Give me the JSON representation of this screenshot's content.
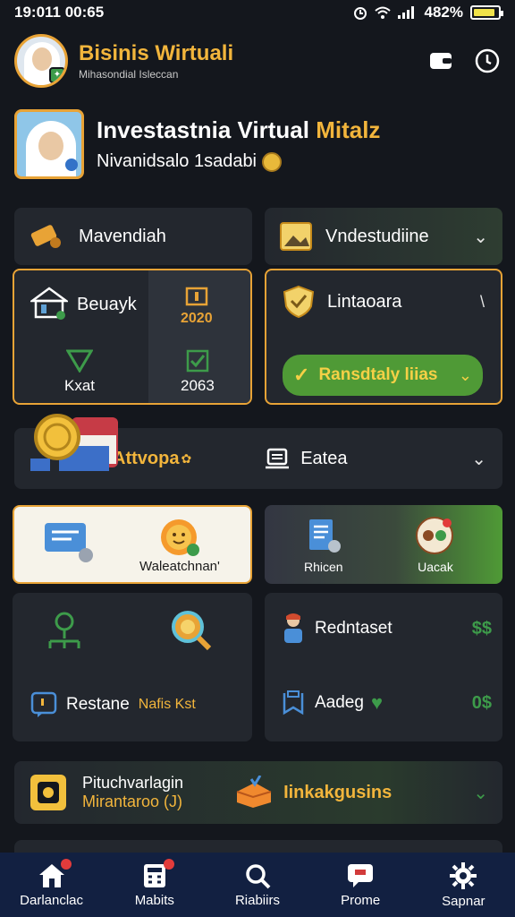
{
  "status": {
    "time": "19:011 00:65",
    "battery": "482%",
    "battery_level": 0.9
  },
  "header": {
    "title": "Bisinis Wirtuali",
    "subtitle": "Mihasondial Isleccan"
  },
  "profile": {
    "title_main": "Investastnia Virtual",
    "title_accent": "Mitalz",
    "subtitle": "Nivanidsalo 1sadabi"
  },
  "row1": {
    "left_label": "Mavendiah",
    "right_label": "Vndestudiine"
  },
  "panel_left": {
    "top_label": "Beuayk",
    "top_value": "2020",
    "bottom_left": "Kxat",
    "bottom_right": "2063"
  },
  "panel_right": {
    "title": "Lintaoara",
    "button_label": "Ransdtaly liias"
  },
  "banner": {
    "left_label": "Attvopa",
    "right_label": "Eatea"
  },
  "row4": {
    "left_caption": "Waleatchnan'",
    "mid_caption": "Rhicen",
    "right_caption": "Uacak"
  },
  "grid": {
    "left_label": "Restane",
    "left_value": "Nafis Kst",
    "right_top_label": "Redntaset",
    "right_top_value": "$$",
    "right_bottom_label": "Aadeg",
    "right_bottom_value": "0$"
  },
  "bottom_card": {
    "line1": "Pituchvarlagin",
    "line2": "Mirantaroo (J)",
    "right_label": "Iinkakgusins"
  },
  "nav": [
    {
      "label": "Darlanclac",
      "icon": "home-icon"
    },
    {
      "label": "Mabits",
      "icon": "calculator-icon"
    },
    {
      "label": "Riabiirs",
      "icon": "search-icon"
    },
    {
      "label": "Prome",
      "icon": "message-icon"
    },
    {
      "label": "Sapnar",
      "icon": "gear-icon"
    }
  ],
  "colors": {
    "gold": "#e8a336",
    "accent_green": "#4f9a36",
    "background": "#14171d",
    "nav_bg": "#122041"
  }
}
